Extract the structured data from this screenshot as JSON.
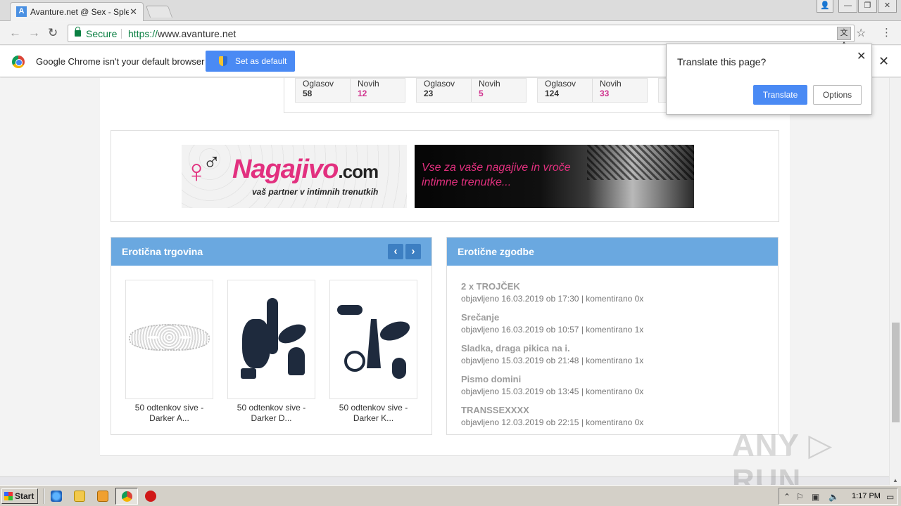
{
  "browser": {
    "tab_title": "Avanture.net @ Sex - Splet",
    "tab_favicon": "A",
    "secure_label": "Secure",
    "url_scheme": "https://",
    "url_rest": "www.avanture.net",
    "icons": {
      "back": "←",
      "forward": "→",
      "reload": "↻",
      "star": "☆",
      "menu": "⋮",
      "translate": "文A",
      "close": "✕"
    }
  },
  "window_controls": {
    "user": "👤",
    "minimize": "—",
    "restore": "❐",
    "close": "✕"
  },
  "infobar": {
    "message": "Google Chrome isn't your default browser",
    "button": "Set as default",
    "close": "✕"
  },
  "translate_popup": {
    "title": "Translate this page?",
    "translate_label": "Translate",
    "options_label": "Options",
    "close": "✕"
  },
  "stats": [
    {
      "ads_label": "Oglasov",
      "ads_value": "58",
      "new_label": "Novih",
      "new_value": "12"
    },
    {
      "ads_label": "Oglasov",
      "ads_value": "23",
      "new_label": "Novih",
      "new_value": "5"
    },
    {
      "ads_label": "Oglasov",
      "ads_value": "124",
      "new_label": "Novih",
      "new_value": "33"
    }
  ],
  "banner": {
    "brand": "Nagajivo",
    "brand_domain": ".com",
    "tagline": "vaš partner v intimnih trenutkih",
    "ad_text": "Vse za vaše nagajive in vroče intimne trenutke..."
  },
  "shop": {
    "title": "Erotična trgovina",
    "prev": "‹",
    "next": "›",
    "products": [
      {
        "name": "50 odtenkov sive - Darker A..."
      },
      {
        "name": "50 odtenkov sive - Darker D..."
      },
      {
        "name": "50 odtenkov sive - Darker K..."
      }
    ]
  },
  "stories": {
    "title": "Erotične zgodbe",
    "items": [
      {
        "title": "2 x TROJČEK",
        "meta": "objavljeno 16.03.2019 ob 17:30 | komentirano 0x"
      },
      {
        "title": "Srečanje",
        "meta": "objavljeno 16.03.2019 ob 10:57 | komentirano 1x"
      },
      {
        "title": "Sladka, draga pikica na i.",
        "meta": "objavljeno 15.03.2019 ob 21:48 | komentirano 1x"
      },
      {
        "title": "Pismo domini",
        "meta": "objavljeno 15.03.2019 ob 13:45 | komentirano 0x"
      },
      {
        "title": "TRANSSEXXXX",
        "meta": "objavljeno 12.03.2019 ob 22:15 | komentirano 0x"
      }
    ]
  },
  "watermark": "ANY ▷ RUN",
  "taskbar": {
    "start_label": "Start",
    "clock": "1:17 PM",
    "tray": {
      "up": "⌃",
      "flag": "⚐",
      "network": "▣",
      "volume": "🔈",
      "display": "▭"
    }
  },
  "colors": {
    "accent": "#4a8af4",
    "panel_head": "#6aa8e0",
    "new_count": "#d0318d",
    "brand_pink": "#e2307f"
  }
}
